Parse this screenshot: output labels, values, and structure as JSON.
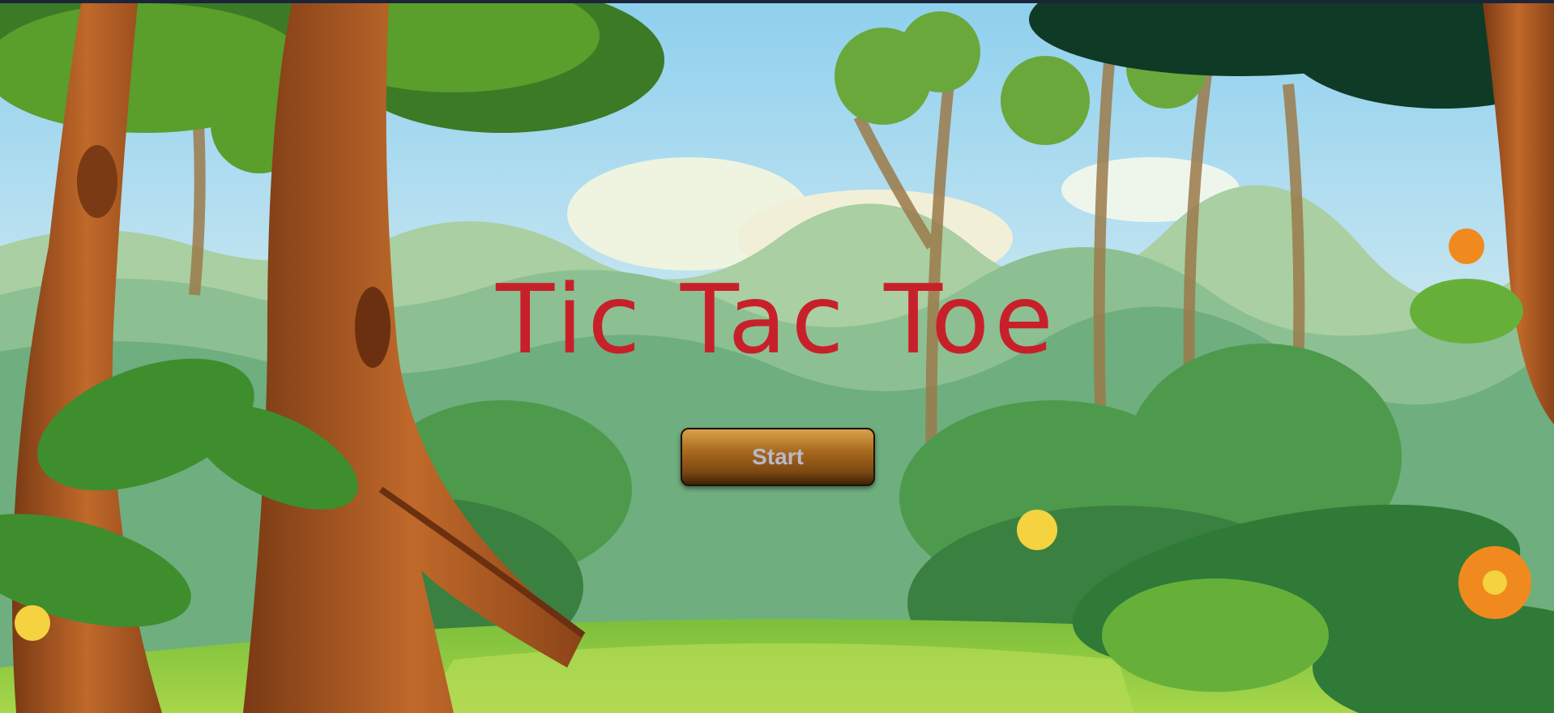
{
  "game": {
    "title": "Tic Tac Toe",
    "start_label": "Start"
  },
  "colors": {
    "title": "#c8202a",
    "button_top": "#d9a14a",
    "button_bottom": "#3d2207",
    "button_text": "#b9b9c8"
  }
}
